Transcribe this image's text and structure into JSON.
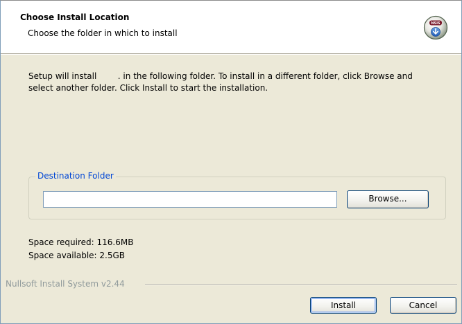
{
  "header": {
    "title": "Choose Install Location",
    "subtitle": "Choose the folder in which to install",
    "icon": "installer-logo-icon"
  },
  "intro": {
    "line1": "Setup will install        . in the following folder. To install in a different folder, click Browse and",
    "line2": "select another folder. Click Install to start the installation."
  },
  "destination": {
    "group_label": "Destination Folder",
    "path_value": "",
    "browse_label": "Browse..."
  },
  "space": {
    "required": "Space required: 116.6MB",
    "available": "Space available: 2.5GB"
  },
  "branding": {
    "text": "Nullsoft Install System v2.44"
  },
  "buttons": {
    "install_label": "Install",
    "cancel_label": "Cancel"
  },
  "colors": {
    "dialog_bg": "#ece9d8",
    "header_bg": "#ffffff",
    "group_label": "#0046d5",
    "branding_text": "#919b9c",
    "button_border": "#003c74"
  }
}
